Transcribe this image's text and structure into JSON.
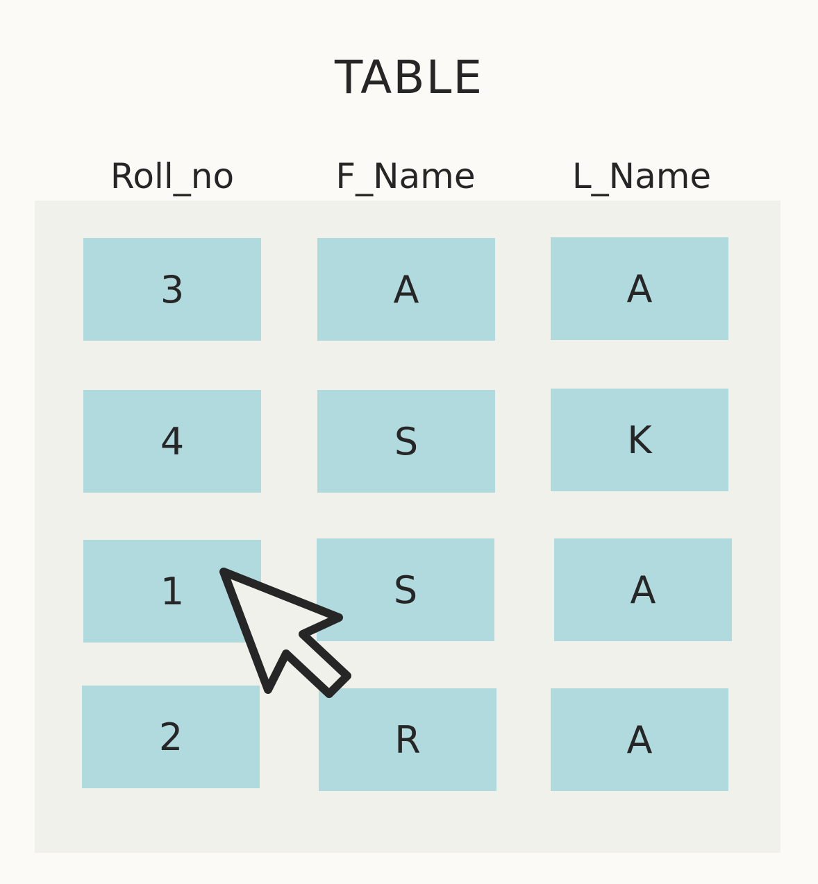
{
  "title": "TABLE",
  "columns": [
    "Roll_no",
    "F_Name",
    "L_Name"
  ],
  "rows": [
    [
      "3",
      "A",
      "A"
    ],
    [
      "4",
      "S",
      "K"
    ],
    [
      "1",
      "S",
      "A"
    ],
    [
      "2",
      "R",
      "A"
    ]
  ],
  "colors": {
    "background": "#fcfaf6",
    "panel": "#f1f1ec",
    "cell": "#b1dadf",
    "text": "#262626"
  },
  "cursor": {
    "icon": "arrow-pointer-icon"
  }
}
